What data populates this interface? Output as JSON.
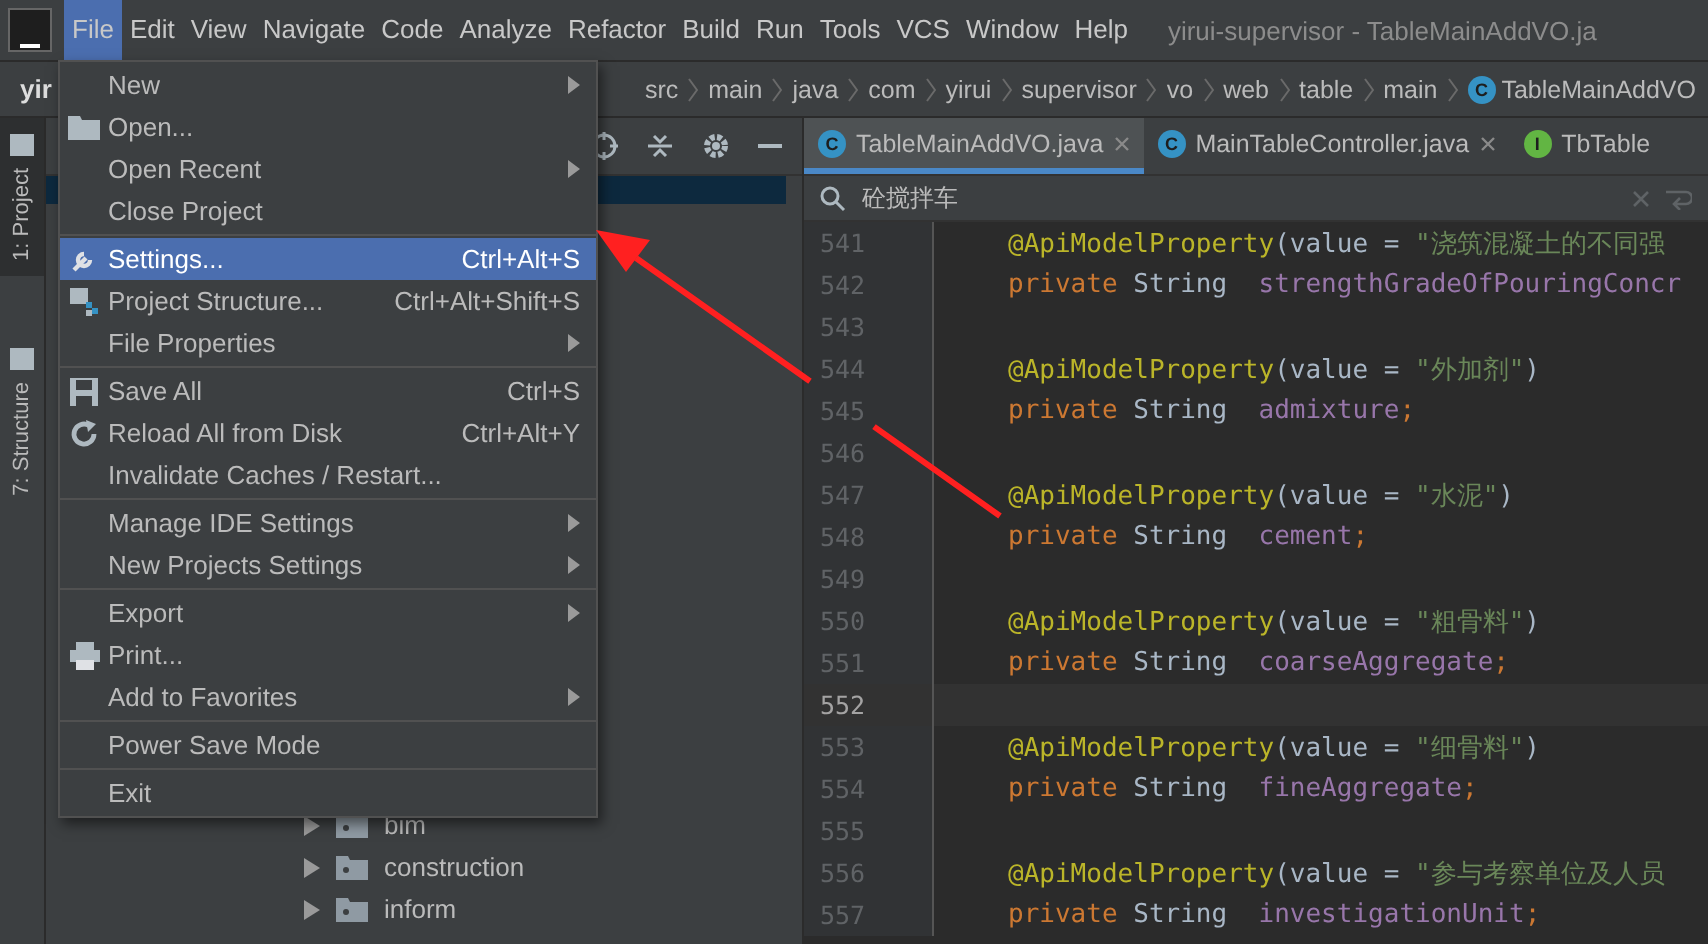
{
  "menu_bar": {
    "items": [
      {
        "label": "File",
        "selected": true
      },
      {
        "label": "Edit",
        "selected": false
      },
      {
        "label": "View",
        "selected": false
      },
      {
        "label": "Navigate",
        "selected": false
      },
      {
        "label": "Code",
        "selected": false
      },
      {
        "label": "Analyze",
        "selected": false
      },
      {
        "label": "Refactor",
        "selected": false
      },
      {
        "label": "Build",
        "selected": false
      },
      {
        "label": "Run",
        "selected": false
      },
      {
        "label": "Tools",
        "selected": false
      },
      {
        "label": "VCS",
        "selected": false
      },
      {
        "label": "Window",
        "selected": false
      },
      {
        "label": "Help",
        "selected": false
      }
    ],
    "window_title": "yirui-supervisor - TableMainAddVO.ja"
  },
  "navigation_bar": {
    "project": "yir",
    "crumbs": [
      {
        "label": "src"
      },
      {
        "label": "main"
      },
      {
        "label": "java"
      },
      {
        "label": "com"
      },
      {
        "label": "yirui"
      },
      {
        "label": "supervisor"
      },
      {
        "label": "vo"
      },
      {
        "label": "web"
      },
      {
        "label": "table"
      },
      {
        "label": "main"
      },
      {
        "label": "TableMainAddVO",
        "badge": "C"
      }
    ]
  },
  "tool_strip": [
    {
      "label": "1: Project",
      "selected": true
    },
    {
      "label": "7: Structure",
      "selected": false
    }
  ],
  "project_tree": {
    "rows": [
      {
        "label": "bim",
        "expanded": false
      },
      {
        "label": "construction",
        "expanded": false
      },
      {
        "label": "inform",
        "expanded": false
      }
    ]
  },
  "editor_tabs": [
    {
      "label": "TableMainAddVO.java",
      "badge": "C",
      "color": "#3592c4",
      "selected": true,
      "closable": true
    },
    {
      "label": "MainTableController.java",
      "badge": "C",
      "color": "#3592c4",
      "selected": false,
      "closable": true
    },
    {
      "label": "TbTable",
      "badge": "I",
      "color": "#62b543",
      "selected": false,
      "closable": false
    }
  ],
  "search": {
    "value": "砼搅拌车"
  },
  "code_lines": [
    {
      "number": "541",
      "current": false,
      "tokens": [
        {
          "kind": "annotation",
          "text": "@ApiModelProperty"
        },
        {
          "kind": "plain",
          "text": "(value = "
        },
        {
          "kind": "string",
          "text": "\"浇筑混凝土的不同强"
        }
      ]
    },
    {
      "number": "542",
      "current": false,
      "tokens": [
        {
          "kind": "keyword",
          "text": "private "
        },
        {
          "kind": "plain",
          "text": "String  "
        },
        {
          "kind": "field",
          "text": "strengthGradeOfPouringConcr"
        }
      ]
    },
    {
      "number": "543",
      "current": false
    },
    {
      "number": "544",
      "current": false,
      "tokens": [
        {
          "kind": "annotation",
          "text": "@ApiModelProperty"
        },
        {
          "kind": "plain",
          "text": "(value = "
        },
        {
          "kind": "string",
          "text": "\"外加剂\""
        },
        {
          "kind": "plain",
          "text": ")"
        }
      ]
    },
    {
      "number": "545",
      "current": false,
      "tokens": [
        {
          "kind": "keyword",
          "text": "private "
        },
        {
          "kind": "plain",
          "text": "String  "
        },
        {
          "kind": "field",
          "text": "admixture"
        },
        {
          "kind": "keyword",
          "text": ";"
        }
      ]
    },
    {
      "number": "546",
      "current": false
    },
    {
      "number": "547",
      "current": false,
      "tokens": [
        {
          "kind": "annotation",
          "text": "@ApiModelProperty"
        },
        {
          "kind": "plain",
          "text": "(value = "
        },
        {
          "kind": "string",
          "text": "\"水泥\""
        },
        {
          "kind": "plain",
          "text": ")"
        }
      ]
    },
    {
      "number": "548",
      "current": false,
      "tokens": [
        {
          "kind": "keyword",
          "text": "private "
        },
        {
          "kind": "plain",
          "text": "String  "
        },
        {
          "kind": "field",
          "text": "cement"
        },
        {
          "kind": "keyword",
          "text": ";"
        }
      ]
    },
    {
      "number": "549",
      "current": false
    },
    {
      "number": "550",
      "current": false,
      "tokens": [
        {
          "kind": "annotation",
          "text": "@ApiModelProperty"
        },
        {
          "kind": "plain",
          "text": "(value = "
        },
        {
          "kind": "string",
          "text": "\"粗骨料\""
        },
        {
          "kind": "plain",
          "text": ")"
        }
      ]
    },
    {
      "number": "551",
      "current": false,
      "tokens": [
        {
          "kind": "keyword",
          "text": "private "
        },
        {
          "kind": "plain",
          "text": "String  "
        },
        {
          "kind": "field",
          "text": "coarseAggregate"
        },
        {
          "kind": "keyword",
          "text": ";"
        }
      ]
    },
    {
      "number": "552",
      "current": true
    },
    {
      "number": "553",
      "current": false,
      "tokens": [
        {
          "kind": "annotation",
          "text": "@ApiModelProperty"
        },
        {
          "kind": "plain",
          "text": "(value = "
        },
        {
          "kind": "string",
          "text": "\"细骨料\""
        },
        {
          "kind": "plain",
          "text": ")"
        }
      ]
    },
    {
      "number": "554",
      "current": false,
      "tokens": [
        {
          "kind": "keyword",
          "text": "private "
        },
        {
          "kind": "plain",
          "text": "String  "
        },
        {
          "kind": "field",
          "text": "fineAggregate"
        },
        {
          "kind": "keyword",
          "text": ";"
        }
      ]
    },
    {
      "number": "555",
      "current": false
    },
    {
      "number": "556",
      "current": false,
      "tokens": [
        {
          "kind": "annotation",
          "text": "@ApiModelProperty"
        },
        {
          "kind": "plain",
          "text": "(value = "
        },
        {
          "kind": "string",
          "text": "\"参与考察单位及人员"
        }
      ]
    },
    {
      "number": "557",
      "current": false,
      "tokens": [
        {
          "kind": "keyword",
          "text": "private "
        },
        {
          "kind": "plain",
          "text": "String  "
        },
        {
          "kind": "field",
          "text": "investigationUnit"
        },
        {
          "kind": "keyword",
          "text": ";"
        }
      ]
    }
  ],
  "file_menu": [
    {
      "kind": "item",
      "label": "New",
      "submenu": true,
      "selected": false
    },
    {
      "kind": "item",
      "label": "Open...",
      "submenu": false,
      "selected": false
    },
    {
      "kind": "item",
      "label": "Open Recent",
      "submenu": true,
      "selected": false
    },
    {
      "kind": "item",
      "label": "Close Project",
      "submenu": false,
      "selected": false
    },
    {
      "kind": "separator"
    },
    {
      "kind": "item",
      "label": "Settings...",
      "shortcut": "Ctrl+Alt+S",
      "submenu": false,
      "selected": true
    },
    {
      "kind": "item",
      "label": "Project Structure...",
      "shortcut": "Ctrl+Alt+Shift+S",
      "submenu": false,
      "selected": false
    },
    {
      "kind": "item",
      "label": "File Properties",
      "submenu": true,
      "selected": false
    },
    {
      "kind": "separator"
    },
    {
      "kind": "item",
      "label": "Save All",
      "shortcut": "Ctrl+S",
      "submenu": false,
      "selected": false
    },
    {
      "kind": "item",
      "label": "Reload All from Disk",
      "shortcut": "Ctrl+Alt+Y",
      "submenu": false,
      "selected": false
    },
    {
      "kind": "item",
      "label": "Invalidate Caches / Restart...",
      "submenu": false,
      "selected": false
    },
    {
      "kind": "separator"
    },
    {
      "kind": "item",
      "label": "Manage IDE Settings",
      "submenu": true,
      "selected": false
    },
    {
      "kind": "item",
      "label": "New Projects Settings",
      "submenu": true,
      "selected": false
    },
    {
      "kind": "separator"
    },
    {
      "kind": "item",
      "label": "Export",
      "submenu": true,
      "selected": false
    },
    {
      "kind": "item",
      "label": "Print...",
      "submenu": false,
      "selected": false
    },
    {
      "kind": "item",
      "label": "Add to Favorites",
      "submenu": true,
      "selected": false
    },
    {
      "kind": "separator"
    },
    {
      "kind": "item",
      "label": "Power Save Mode",
      "submenu": false,
      "selected": false
    },
    {
      "kind": "separator"
    },
    {
      "kind": "item",
      "label": "Exit",
      "submenu": false,
      "selected": false
    }
  ]
}
